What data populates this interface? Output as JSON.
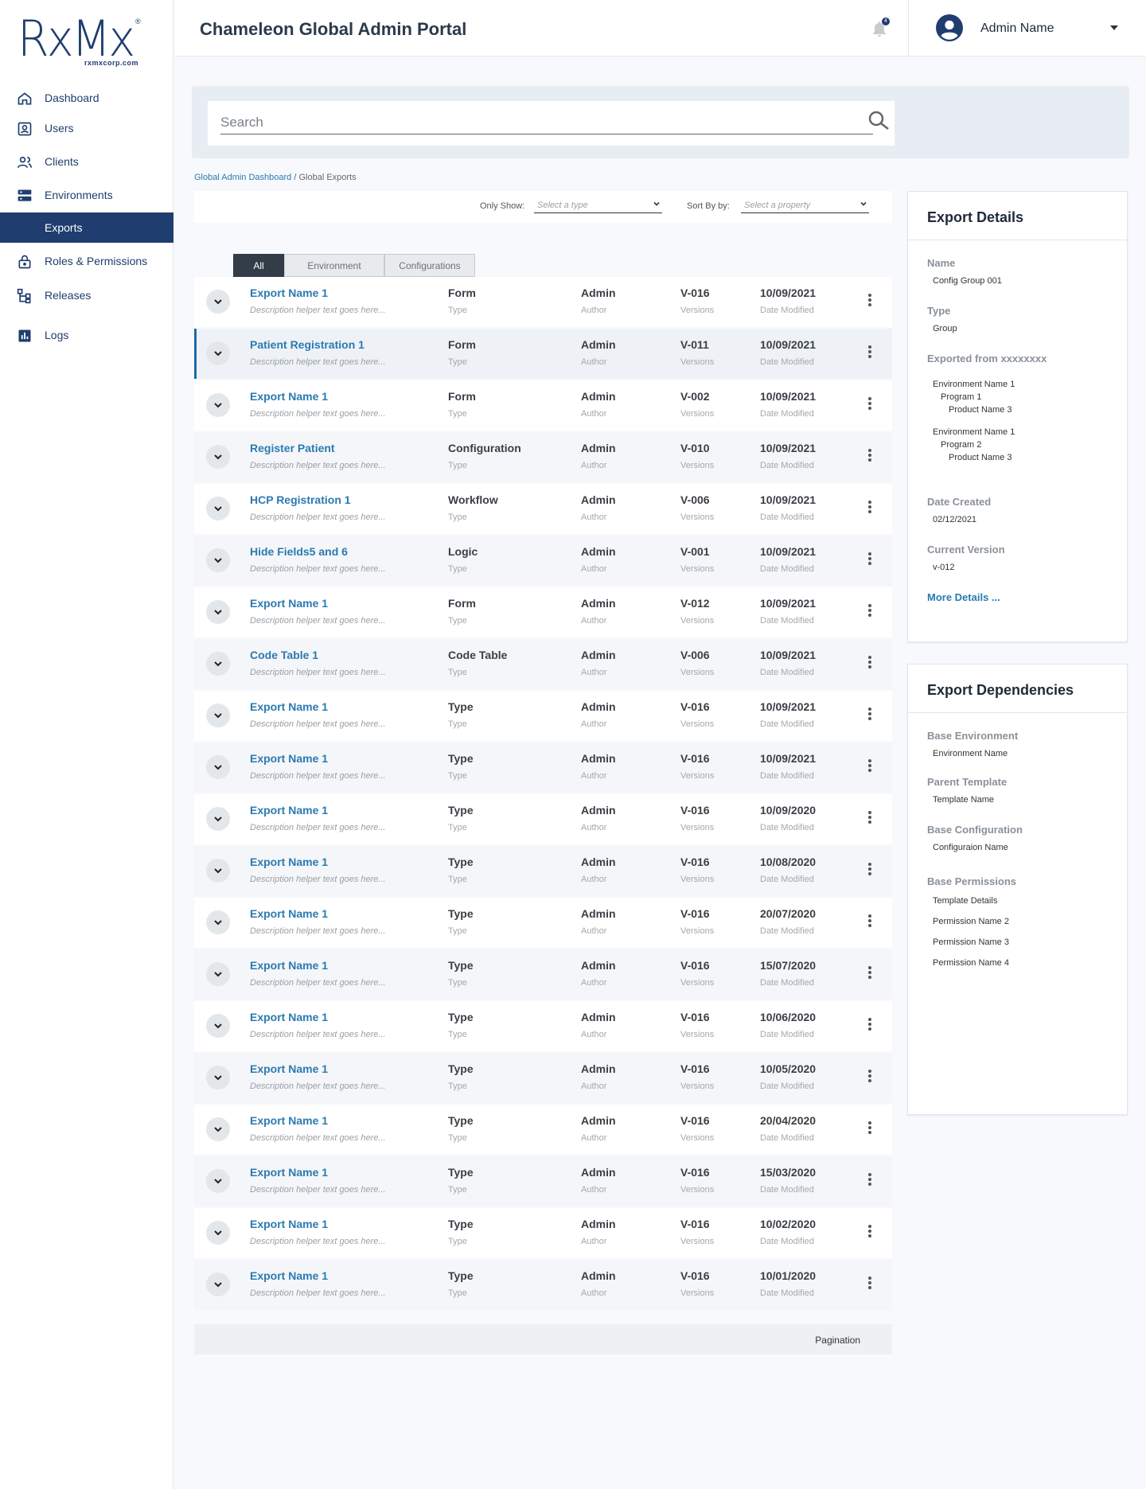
{
  "logo": {
    "main": "RxMx",
    "sub": "rxmxcorp.com",
    "reg": "®"
  },
  "sidebar": {
    "items": [
      {
        "label": "Dashboard",
        "icon": "home-icon"
      },
      {
        "label": "Users",
        "icon": "user-badge-icon"
      },
      {
        "label": "Clients",
        "icon": "people-icon"
      },
      {
        "label": "Environments",
        "icon": "server-icon"
      },
      {
        "label": "Exports",
        "icon": "",
        "active": true
      },
      {
        "label": "Roles & Permissions",
        "icon": "lock-icon"
      },
      {
        "label": "Releases",
        "icon": "hierarchy-icon"
      },
      {
        "label": "Logs",
        "icon": "chart-icon"
      }
    ]
  },
  "header": {
    "title": "Chameleon Global Admin Portal",
    "notification_count": "4",
    "user_name": "Admin Name"
  },
  "search": {
    "placeholder": "Search"
  },
  "breadcrumb": {
    "root": "Global Admin Dashboard",
    "separator": " / ",
    "current": "Global Exports"
  },
  "filters": {
    "only_show_label": "Only Show:",
    "only_show_placeholder": "Select a type",
    "sort_label": "Sort By by:",
    "sort_placeholder": "Select a property"
  },
  "tabs": [
    {
      "label": "All",
      "active": true
    },
    {
      "label": "Environment"
    },
    {
      "label": "Configurations"
    }
  ],
  "table": {
    "sub_labels": {
      "type": "Type",
      "author": "Author",
      "versions": "Versions",
      "date": "Date Modified"
    },
    "rows": [
      {
        "name": "Export Name 1",
        "desc": "Description helper text goes here...",
        "type": "Form",
        "author": "Admin",
        "version": "V-016",
        "date": "10/09/2021"
      },
      {
        "name": "Patient Registration 1",
        "desc": "Description helper text goes here...",
        "type": "Form",
        "author": "Admin",
        "version": "V-011",
        "date": "10/09/2021",
        "selected": true
      },
      {
        "name": "Export Name 1",
        "desc": "Description helper text goes here...",
        "type": "Form",
        "author": "Admin",
        "version": "V-002",
        "date": "10/09/2021"
      },
      {
        "name": "Register Patient",
        "desc": "Description helper text goes here...",
        "type": "Configuration",
        "author": "Admin",
        "version": "V-010",
        "date": "10/09/2021"
      },
      {
        "name": "HCP Registration 1",
        "desc": "Description helper text goes here...",
        "type": "Workflow",
        "author": "Admin",
        "version": "V-006",
        "date": "10/09/2021"
      },
      {
        "name": "Hide Fields5 and 6",
        "desc": "Description helper text goes here...",
        "type": "Logic",
        "author": "Admin",
        "version": "V-001",
        "date": "10/09/2021"
      },
      {
        "name": "Export Name 1",
        "desc": "Description helper text goes here...",
        "type": "Form",
        "author": "Admin",
        "version": "V-012",
        "date": "10/09/2021"
      },
      {
        "name": "Code Table 1",
        "desc": "Description helper text goes here...",
        "type": "Code Table",
        "author": "Admin",
        "version": "V-006",
        "date": "10/09/2021"
      },
      {
        "name": "Export Name 1",
        "desc": "Description helper text goes here...",
        "type": "Type",
        "author": "Admin",
        "version": "V-016",
        "date": "10/09/2021"
      },
      {
        "name": "Export Name 1",
        "desc": "Description helper text goes here...",
        "type": "Type",
        "author": "Admin",
        "version": "V-016",
        "date": "10/09/2021"
      },
      {
        "name": "Export Name 1",
        "desc": "Description helper text goes here...",
        "type": "Type",
        "author": "Admin",
        "version": "V-016",
        "date": "10/09/2020"
      },
      {
        "name": "Export Name 1",
        "desc": "Description helper text goes here...",
        "type": "Type",
        "author": "Admin",
        "version": "V-016",
        "date": "10/08/2020"
      },
      {
        "name": "Export Name 1",
        "desc": "Description helper text goes here...",
        "type": "Type",
        "author": "Admin",
        "version": "V-016",
        "date": "20/07/2020"
      },
      {
        "name": "Export Name 1",
        "desc": "Description helper text goes here...",
        "type": "Type",
        "author": "Admin",
        "version": "V-016",
        "date": "15/07/2020"
      },
      {
        "name": "Export Name 1",
        "desc": "Description helper text goes here...",
        "type": "Type",
        "author": "Admin",
        "version": "V-016",
        "date": "10/06/2020"
      },
      {
        "name": "Export Name 1",
        "desc": "Description helper text goes here...",
        "type": "Type",
        "author": "Admin",
        "version": "V-016",
        "date": "10/05/2020"
      },
      {
        "name": "Export Name 1",
        "desc": "Description helper text goes here...",
        "type": "Type",
        "author": "Admin",
        "version": "V-016",
        "date": "20/04/2020"
      },
      {
        "name": "Export Name 1",
        "desc": "Description helper text goes here...",
        "type": "Type",
        "author": "Admin",
        "version": "V-016",
        "date": "15/03/2020"
      },
      {
        "name": "Export Name 1",
        "desc": "Description helper text goes here...",
        "type": "Type",
        "author": "Admin",
        "version": "V-016",
        "date": "10/02/2020"
      },
      {
        "name": "Export Name 1",
        "desc": "Description helper text goes here...",
        "type": "Type",
        "author": "Admin",
        "version": "V-016",
        "date": "10/01/2020"
      }
    ]
  },
  "pagination": {
    "label": "Pagination"
  },
  "export_details": {
    "title": "Export Details",
    "name_label": "Name",
    "name_value": "Config Group 001",
    "type_label": "Type",
    "type_value": "Group",
    "exported_label": "Exported from xxxxxxxx",
    "exported_lines": [
      "Environment Name 1",
      "Program 1",
      "Product Name 3",
      "Environment Name 1",
      "Program 2",
      "Product Name 3"
    ],
    "created_label": "Date Created",
    "created_value": "02/12/2021",
    "version_label": "Current Version",
    "version_value": "v-012",
    "more_link": "More Details ..."
  },
  "export_dependencies": {
    "title": "Export Dependencies",
    "base_env_label": "Base Environment",
    "base_env_value": "Environment Name",
    "parent_label": "Parent Template",
    "parent_value": "Template Name",
    "base_config_label": "Base Configuration",
    "base_config_value": "Configuraion Name",
    "base_perm_label": "Base Permissions",
    "base_perm_values": [
      "Template Details",
      "Permission Name 2",
      "Permission Name 3",
      "Permission Name 4"
    ]
  },
  "colors": {
    "brand": "#1f3d6e",
    "link": "#2b7ab0",
    "tab_active": "#323d48"
  }
}
